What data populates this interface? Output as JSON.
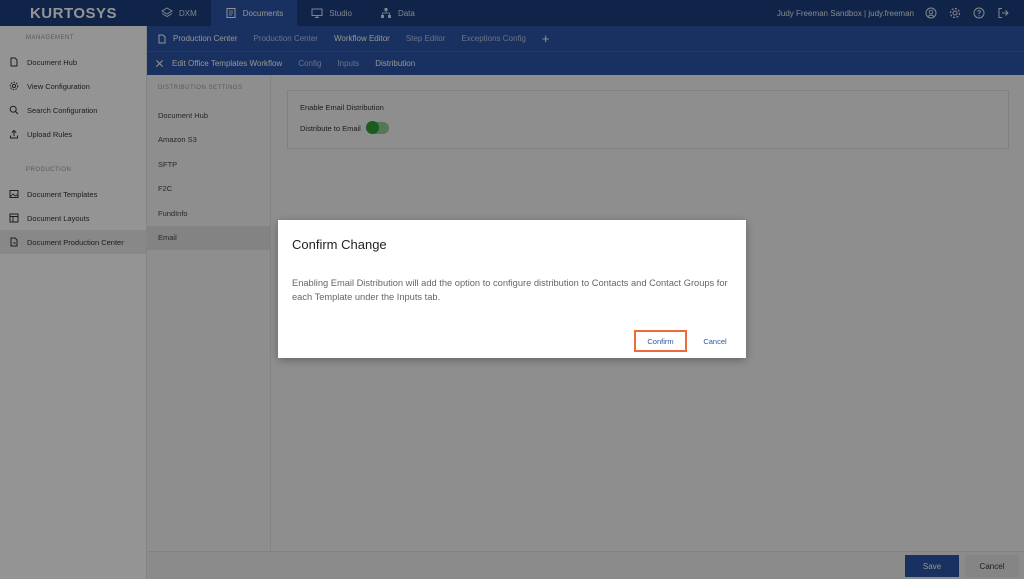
{
  "brand": "KURTOSYS",
  "topnav": [
    {
      "label": "DXM",
      "icon": "layers-icon"
    },
    {
      "label": "Documents",
      "icon": "documents-icon"
    },
    {
      "label": "Studio",
      "icon": "monitor-icon"
    },
    {
      "label": "Data",
      "icon": "hierarchy-icon"
    }
  ],
  "user": {
    "text": "Judy Freeman Sandbox | judy.freeman"
  },
  "sidebar": {
    "section_management": "MANAGEMENT",
    "management_items": [
      {
        "label": "Document Hub",
        "icon": "file-icon"
      },
      {
        "label": "View Configuration",
        "icon": "gear-icon"
      },
      {
        "label": "Search Configuration",
        "icon": "search-icon"
      },
      {
        "label": "Upload Rules",
        "icon": "upload-icon"
      }
    ],
    "section_production": "PRODUCTION",
    "production_items": [
      {
        "label": "Document Templates",
        "icon": "image-icon"
      },
      {
        "label": "Document Layouts",
        "icon": "layout-icon"
      },
      {
        "label": "Document Production Center",
        "icon": "file-export-icon"
      }
    ]
  },
  "header1": {
    "items": [
      "Production Center",
      "Production Center",
      "Workflow Editor",
      "Step Editor",
      "Exceptions Config"
    ],
    "add": "+"
  },
  "header2": {
    "title": "Edit Office Templates Workflow",
    "tabs": [
      "Config",
      "Inputs",
      "Distribution"
    ]
  },
  "settings": {
    "title": "DISTRIBUTION SETTINGS",
    "items": [
      "Document Hub",
      "Amazon S3",
      "SFTP",
      "F2C",
      "FundInfo",
      "Email"
    ]
  },
  "panel": {
    "heading": "Enable Email Distribution",
    "toggle_label": "Distribute to Email",
    "toggle_on": true
  },
  "footer": {
    "save": "Save",
    "cancel": "Cancel"
  },
  "modal": {
    "title": "Confirm Change",
    "body": "Enabling Email Distribution will add the option to configure distribution to Contacts and Contact Groups for each Template under the Inputs tab.",
    "confirm": "Confirm",
    "cancel": "Cancel"
  },
  "colors": {
    "topbar": "#1b3e7c",
    "accent": "#2b55a6",
    "highlight": "#ee6a3c",
    "toggle": "#2e9d3a"
  }
}
